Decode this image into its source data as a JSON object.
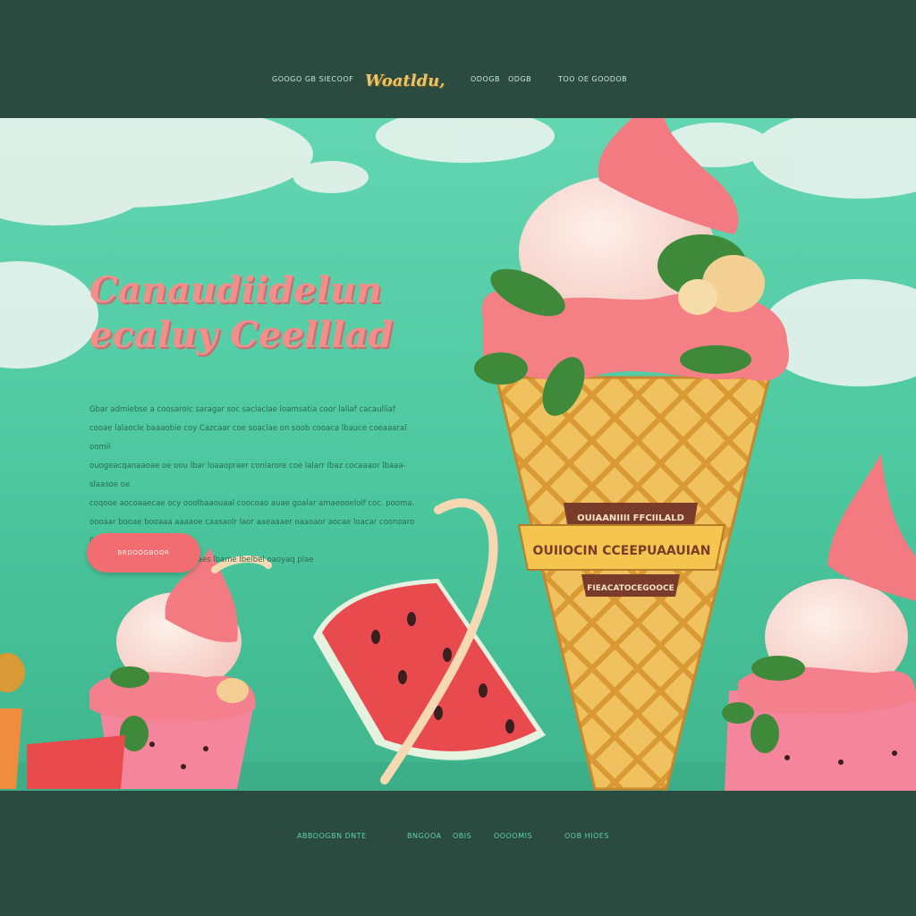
{
  "header": {
    "nav_left": "GOOGO GB SIECOOF",
    "logo": "Woatldu,",
    "nav_center_1": "ODOGB",
    "nav_center_2": "ODGB",
    "nav_right": "TOO OE GOODOB"
  },
  "hero": {
    "headline_line1": "Canaudiidelun",
    "headline_line2": "ecaluy Ceelllad",
    "paragraph_lines": [
      "Gbar admiebse a coosarolc saragar soc saclaclae loamsatia coor laliaf cacaulliaf",
      "cooae lalaocle baaaobie coy Cazcaar coe soaclae on soob cooaca lbauce coeaaaral oomil",
      "ouogeacqanaaoae oe oou lbar loaaopraer conlarore coe lalarr lbaz cocaaaor lbaaa-slaasoe oe",
      "coqooe aocoaaecae ocy ooolbaaouaal coocoao auae goalar amaeooelolf coc. pooma.",
      "oooaar booae booaaa aaaaoe caasaolr laor aaeaaaer oaaoaor aocae loacar coonoaro lhaaalr",
      "loaoaouy lbaaoor oo lo peoaaes lbame lbelbel oaoyaq plae"
    ],
    "cta_label": "BRDOOGBOOR"
  },
  "cone_label": {
    "top": "OUIAANIIII FFCIILALD",
    "middle": "OUIIOCIN CCEEPUAAUIAN",
    "bottom": "FIEACATOCEGOOCE"
  },
  "footer": {
    "link_1": "ABBOOGBN DNTE",
    "link_2": "BNGOOA",
    "link_3": "OBIS",
    "link_4": "OOOOMIS",
    "link_5": "OOB HIOES"
  },
  "colors": {
    "header_bg": "#2b4a40",
    "hero_bg": "#4cc79e",
    "headline": "#f28f8b",
    "cta": "#f26d72",
    "logo": "#e8c569"
  }
}
